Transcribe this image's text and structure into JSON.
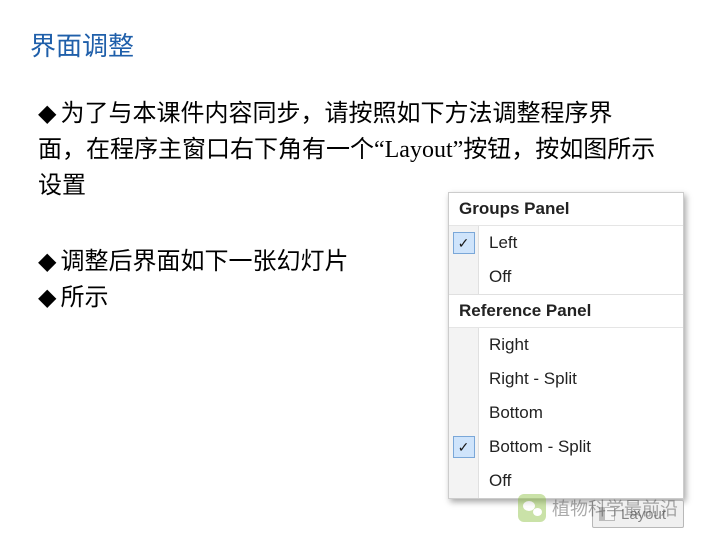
{
  "title": "界面调整",
  "bullets": [
    "为了与本课件内容同步，请按照如下方法调整程序界面，在程序主窗口右下角有一个“Layout”按钮，按如图所示设置",
    "调整后界面如下一张幻灯片",
    "所示"
  ],
  "layoutMenu": {
    "sections": [
      {
        "header": "Groups Panel",
        "items": [
          {
            "label": "Left",
            "checked": true
          },
          {
            "label": "Off",
            "checked": false
          }
        ]
      },
      {
        "header": "Reference Panel",
        "items": [
          {
            "label": "Right",
            "checked": false
          },
          {
            "label": "Right - Split",
            "checked": false
          },
          {
            "label": "Bottom",
            "checked": false
          },
          {
            "label": "Bottom - Split",
            "checked": true
          },
          {
            "label": "Off",
            "checked": false
          }
        ]
      }
    ]
  },
  "layoutButton": {
    "label": "Layout"
  },
  "watermark": "植物科学最前沿"
}
